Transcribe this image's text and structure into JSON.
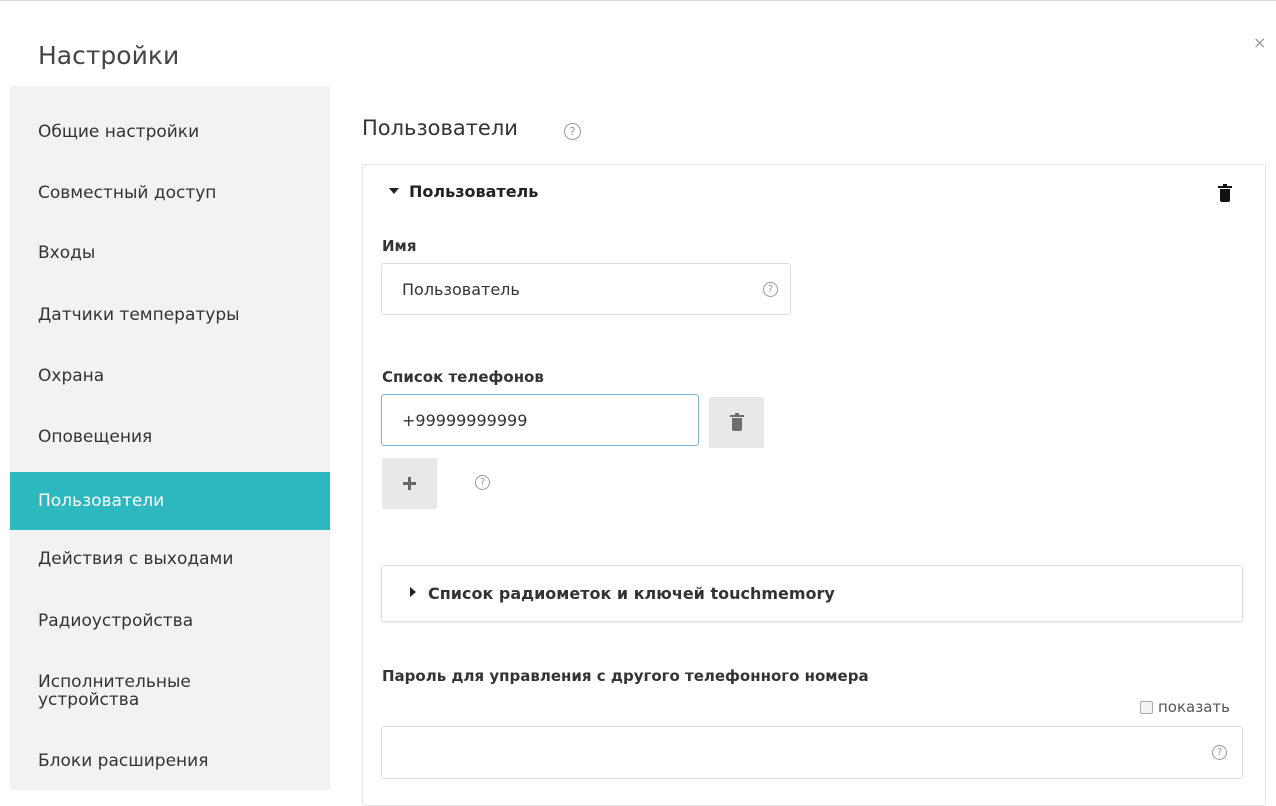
{
  "dialog": {
    "title": "Настройки",
    "close_symbol": "×"
  },
  "sidebar": {
    "items": [
      {
        "label": "Общие настройки"
      },
      {
        "label": "Совместный доступ"
      },
      {
        "label": "Входы"
      },
      {
        "label": "Датчики температуры"
      },
      {
        "label": "Охрана"
      },
      {
        "label": "Оповещения"
      },
      {
        "label": "Пользователи",
        "active": true
      },
      {
        "label": "Действия с выходами"
      },
      {
        "label": "Радиоустройства"
      },
      {
        "label_line1": "Исполнительные",
        "label_line2": "устройства"
      },
      {
        "label": "Блоки расширения"
      }
    ]
  },
  "main": {
    "title": "Пользователи",
    "help_symbol": "?",
    "user_panel": {
      "header": "Пользователь",
      "name_label": "Имя",
      "name_value": "Пользователь",
      "phones_label": "Список телефонов",
      "phone_value": "+99999999999",
      "radio_section": "Список радиометок и ключей touchmemory",
      "password_label": "Пароль для управления с другого телефонного номера",
      "show_label": "показать",
      "password_value": ""
    }
  },
  "colors": {
    "accent": "#2db8c0",
    "sidebar_bg": "#f2f2f2",
    "button_bg": "#e8e8e8"
  },
  "icons": [
    "close-icon",
    "help-icon",
    "caret-down-icon",
    "caret-right-icon",
    "trash-icon",
    "plus-icon"
  ]
}
